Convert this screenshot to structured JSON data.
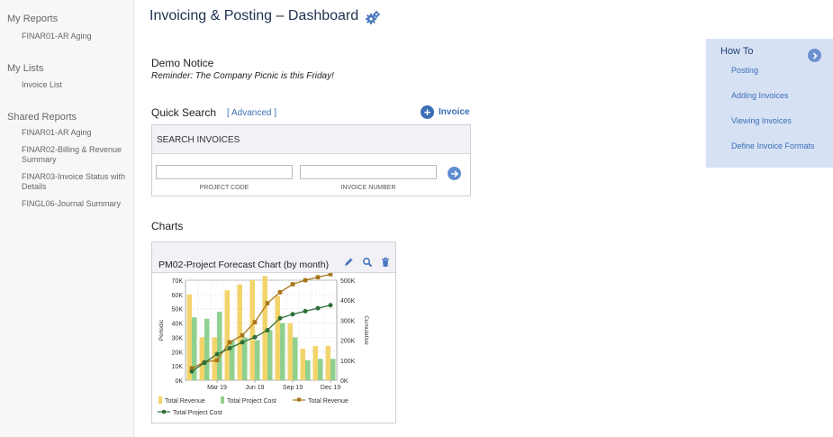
{
  "sidebar": {
    "my_reports": {
      "title": "My Reports",
      "items": [
        "FINAR01-AR Aging"
      ]
    },
    "my_lists": {
      "title": "My Lists",
      "items": [
        "Invoice List"
      ]
    },
    "shared_reports": {
      "title": "Shared Reports",
      "items": [
        "FINAR01-AR Aging",
        "FINAR02-Billing & Revenue Summary",
        "FINAR03-Invoice Status with Details",
        "FINGL06-Journal Summary"
      ]
    }
  },
  "header": {
    "title": "Invoicing & Posting – Dashboard"
  },
  "notice": {
    "title": "Demo Notice",
    "text": "Reminder: The Company Picnic is this Friday!"
  },
  "quick_search": {
    "title": "Quick Search",
    "advanced_label": "[ Advanced ]",
    "invoice_button": "Invoice",
    "box_title": "SEARCH INVOICES",
    "project_code_value": "",
    "invoice_number_value": "",
    "project_code_label": "PROJECT CODE",
    "invoice_number_label": "INVOICE NUMBER"
  },
  "charts": {
    "title": "Charts",
    "card_title": "PM02-Project Forecast Chart (by month)"
  },
  "how_to": {
    "title": "How To",
    "items": [
      "Posting",
      "Adding Invoices",
      "Viewing Invoices",
      "Define Invoice Formats"
    ]
  },
  "colors": {
    "accent": "#3b6fb6",
    "revenue_bar": "#f2d46b",
    "cost_bar": "#8fd08f",
    "revenue_line": "#a8751a",
    "cost_line": "#2f6e38"
  },
  "chart_data": {
    "type": "bar",
    "categories": [
      "Jan 19",
      "Feb 19",
      "Mar 19",
      "Apr 19",
      "May 19",
      "Jun 19",
      "Jul 19",
      "Aug 19",
      "Sep 19",
      "Oct 19",
      "Nov 19",
      "Dec 19"
    ],
    "tick_labels": [
      "Mar 19",
      "Jun 19",
      "Sep 19",
      "Dec 19"
    ],
    "left_axis": {
      "label": "Periodic",
      "ylim": [
        0,
        70000
      ],
      "ticks": [
        "0K",
        "10K",
        "20K",
        "30K",
        "40K",
        "50K",
        "60K",
        "70K"
      ]
    },
    "right_axis": {
      "label": "Cumulative",
      "ylim": [
        0,
        500000
      ],
      "ticks": [
        "0K",
        "100K",
        "200K",
        "300K",
        "400K",
        "500K"
      ]
    },
    "series": [
      {
        "name": "Total Revenue",
        "kind": "bar",
        "axis": "left",
        "values": [
          60000,
          30000,
          30000,
          63000,
          67000,
          70000,
          73000,
          59000,
          40000,
          22000,
          24000,
          24000
        ]
      },
      {
        "name": "Total Project Cost",
        "kind": "bar",
        "axis": "left",
        "values": [
          44000,
          43000,
          48000,
          28000,
          30000,
          28000,
          35000,
          40000,
          30000,
          14000,
          15000,
          15000
        ]
      },
      {
        "name": "Total Revenue",
        "kind": "line",
        "axis": "right",
        "values": [
          60000,
          90000,
          100000,
          190000,
          225000,
          290000,
          385000,
          440000,
          480000,
          500000,
          515000,
          530000
        ]
      },
      {
        "name": "Total Project Cost",
        "kind": "line",
        "axis": "right",
        "values": [
          44000,
          87000,
          130000,
          160000,
          190000,
          215000,
          250000,
          310000,
          330000,
          345000,
          360000,
          375000
        ]
      }
    ],
    "legend": {
      "placement": "bottom"
    },
    "grid": true
  }
}
